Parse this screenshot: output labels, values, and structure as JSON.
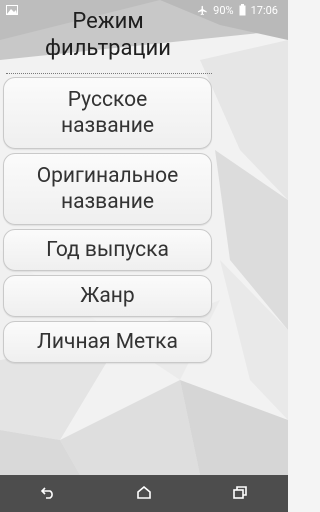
{
  "status_bar": {
    "notification_icon": "gallery-icon",
    "airplane_icon": "airplane-icon",
    "battery_percent": "90%",
    "battery_icon": "battery-icon",
    "time": "17:06"
  },
  "page": {
    "title_line1": "Режим",
    "title_line2": "фильтрации"
  },
  "options": [
    {
      "label": "Русское\nназвание"
    },
    {
      "label": "Оригинальное\nназвание"
    },
    {
      "label": "Год выпуска"
    },
    {
      "label": "Жанр"
    },
    {
      "label": "Личная Метка"
    }
  ],
  "nav_bar": {
    "back_icon": "back-icon",
    "home_icon": "home-icon",
    "recents_icon": "recents-icon",
    "color": "#4d4d4d"
  }
}
